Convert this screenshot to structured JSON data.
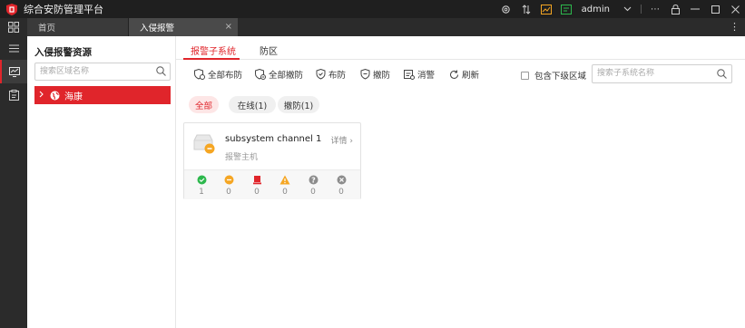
{
  "app": {
    "title": "综合安防管理平台",
    "user": "admin"
  },
  "tabs": [
    {
      "label": "首页"
    },
    {
      "label": "入侵报警"
    }
  ],
  "resource_panel": {
    "title": "入侵报警资源",
    "search_placeholder": "搜索区域名称",
    "tree": [
      {
        "label": "海康"
      }
    ]
  },
  "sub_tabs": [
    {
      "label": "报警子系统"
    },
    {
      "label": "防区"
    }
  ],
  "toolbar": {
    "arm_all": "全部布防",
    "disarm_all": "全部撤防",
    "arm": "布防",
    "disarm": "撤防",
    "clear_alarm": "消警",
    "refresh": "刷新",
    "include_sub": "包含下级区域",
    "search_placeholder": "搜索子系统名称"
  },
  "filters": [
    {
      "label": "全部"
    },
    {
      "label": "在线(1)"
    },
    {
      "label": "撤防(1)"
    }
  ],
  "card": {
    "name": "subsystem channel 1",
    "type": "报警主机",
    "detail": "详情",
    "stats": [
      {
        "icon": "check-circle-icon",
        "value": "1",
        "color": "#2db84d"
      },
      {
        "icon": "minus-circle-icon",
        "value": "0",
        "color": "#f5a623"
      },
      {
        "icon": "alarm-device-icon",
        "value": "0",
        "color": "#e0252b"
      },
      {
        "icon": "warning-triangle-icon",
        "value": "0",
        "color": "#f5a623"
      },
      {
        "icon": "question-circle-icon",
        "value": "0",
        "color": "#8c8c8c"
      },
      {
        "icon": "close-circle-icon",
        "value": "0",
        "color": "#8c8c8c"
      }
    ]
  },
  "colors": {
    "accent": "#e0252b",
    "titlebar": "#1f1f1f",
    "nav": "#2b2b2b"
  }
}
